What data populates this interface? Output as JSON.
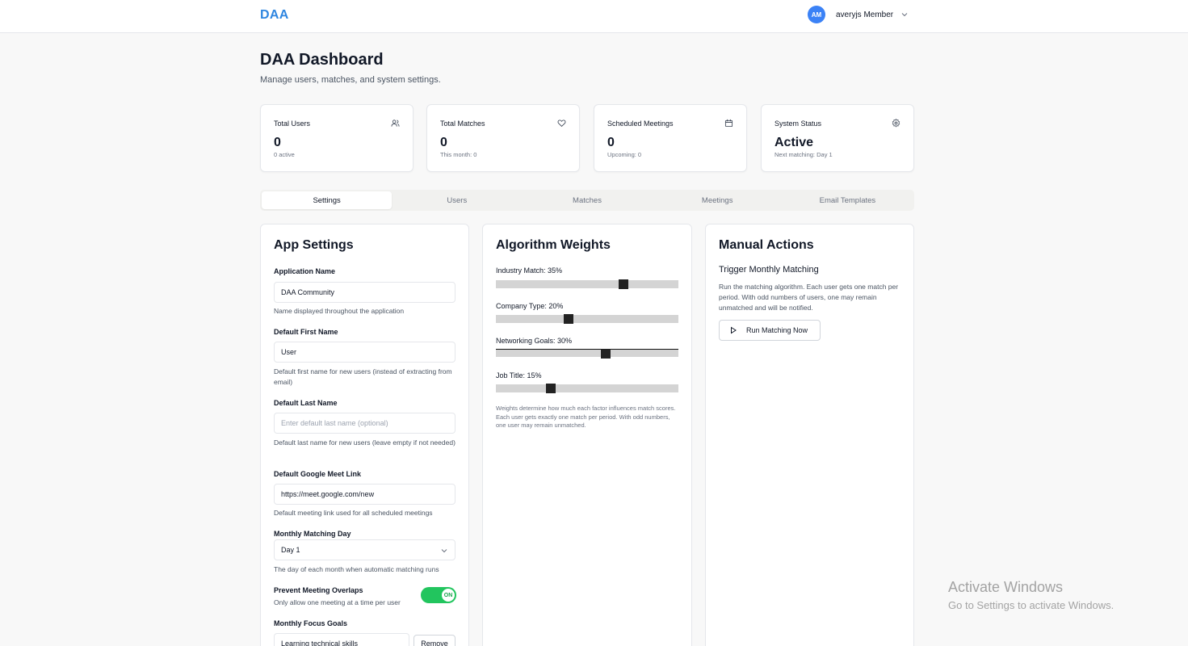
{
  "header": {
    "brand": "DAA",
    "user": {
      "initials": "AM",
      "name": "averyjs Member"
    }
  },
  "page": {
    "title": "DAA Dashboard",
    "subtitle": "Manage users, matches, and system settings."
  },
  "stats": [
    {
      "label": "Total Users",
      "value": "0",
      "note": "0 active",
      "icon": "users-icon"
    },
    {
      "label": "Total Matches",
      "value": "0",
      "note": "This month: 0",
      "icon": "heart-icon"
    },
    {
      "label": "Scheduled Meetings",
      "value": "0",
      "note": "Upcoming: 0",
      "icon": "calendar-icon"
    },
    {
      "label": "System Status",
      "value": "Active",
      "note": "Next matching: Day 1",
      "icon": "gear-icon"
    }
  ],
  "tabs": [
    {
      "label": "Settings",
      "active": true
    },
    {
      "label": "Users",
      "active": false
    },
    {
      "label": "Matches",
      "active": false
    },
    {
      "label": "Meetings",
      "active": false
    },
    {
      "label": "Email Templates",
      "active": false
    }
  ],
  "app_settings": {
    "title": "App Settings",
    "app_name": {
      "label": "Application Name",
      "value": "DAA Community",
      "help": "Name displayed throughout the application"
    },
    "first_name": {
      "label": "Default First Name",
      "value": "User",
      "help": "Default first name for new users (instead of extracting from email)"
    },
    "last_name": {
      "label": "Default Last Name",
      "value": "",
      "placeholder": "Enter default last name (optional)",
      "help": "Default last name for new users (leave empty if not needed)"
    },
    "meet_link": {
      "label": "Default Google Meet Link",
      "value": "https://meet.google.com/new",
      "help": "Default meeting link used for all scheduled meetings"
    },
    "matching_day": {
      "label": "Monthly Matching Day",
      "selected": "Day 1",
      "help": "The day of each month when automatic matching runs"
    },
    "overlaps": {
      "label": "Prevent Meeting Overlaps",
      "help": "Only allow one meeting at a time per user",
      "state": "ON",
      "on": true
    },
    "focus_goals": {
      "label": "Monthly Focus Goals",
      "first_value": "Learning technical skills",
      "remove_label": "Remove"
    }
  },
  "algorithm_weights": {
    "title": "Algorithm Weights",
    "weights": [
      {
        "label": "Industry Match: 35%",
        "value": 35
      },
      {
        "label": "Company Type: 20%",
        "value": 20
      },
      {
        "label": "Networking Goals: 30%",
        "value": 30
      },
      {
        "label": "Job Title: 15%",
        "value": 15
      }
    ],
    "note": "Weights determine how much each factor influences match scores. Each user gets exactly one match per period. With odd numbers, one user may remain unmatched."
  },
  "manual_actions": {
    "title": "Manual Actions",
    "subtitle": "Trigger Monthly Matching",
    "description": "Run the matching algorithm. Each user gets one match per period. With odd numbers of users, one may remain unmatched and will be notified.",
    "run_button": "Run Matching Now"
  },
  "watermark": {
    "title": "Activate Windows",
    "subtitle": "Go to Settings to activate Windows."
  },
  "colors": {
    "brand": "#2f86e0",
    "avatar": "#3b82f6",
    "toggle_on": "#22c55e"
  }
}
